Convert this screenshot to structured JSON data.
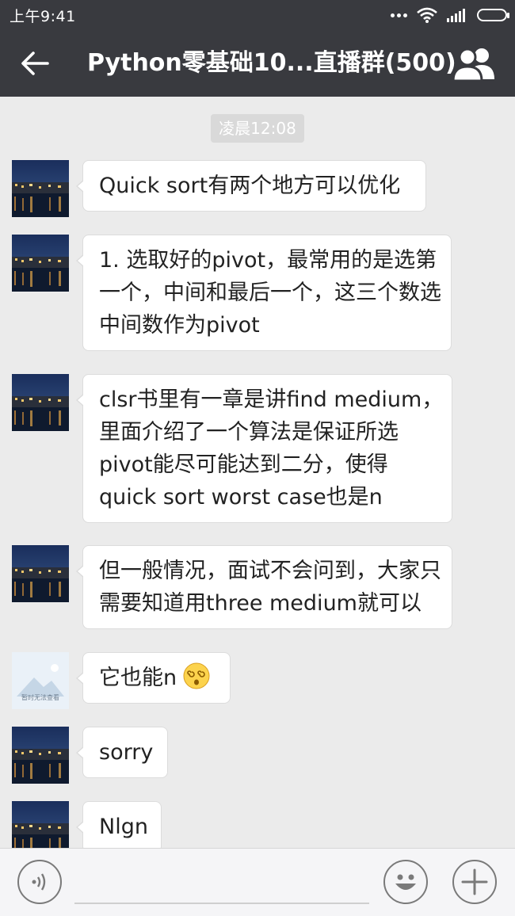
{
  "status_bar": {
    "time": "上午9:41"
  },
  "header": {
    "title": "Python零基础10...直播群(500)"
  },
  "chat": {
    "timestamp": "凌晨12:08",
    "messages": [
      {
        "avatar": "city-night-photo",
        "lines": [
          "Quick sort有两个地方可以优化"
        ]
      },
      {
        "avatar": "city-night-photo",
        "lines": [
          "1. 选取好的pivot，最常用的是选第",
          "一个，中间和最后一个，这三个数选",
          "中间数作为pivot"
        ]
      },
      {
        "avatar": "city-night-photo",
        "lines": [
          "clsr书里有一章是讲find medium，",
          "里面介绍了一个算法是保证所选",
          "pivot能尽可能达到二分，使得",
          "quick sort worst case也是n"
        ]
      },
      {
        "avatar": "city-night-photo",
        "lines": [
          "但一般情况，面试不会问到，大家只",
          "需要知道用three medium就可以"
        ]
      },
      {
        "avatar": "placeholder-image",
        "avatar_caption": "暂时无法查看",
        "lines": [
          "它也能n"
        ],
        "emoji": "dizzy-face"
      },
      {
        "avatar": "city-night-photo",
        "lines": [
          "sorry"
        ]
      },
      {
        "avatar": "city-night-photo",
        "lines": [
          "Nlgn"
        ]
      }
    ]
  },
  "icons": {
    "back": "back-arrow-icon",
    "group": "group-members-icon",
    "voice": "voice-input-icon",
    "emoji": "emoji-icon",
    "plus": "plus-icon"
  },
  "colors": {
    "header_bg": "#393a3f",
    "chat_bg": "#ebebeb",
    "bubble_bg": "#ffffff",
    "input_bar_bg": "#f5f5f7"
  }
}
